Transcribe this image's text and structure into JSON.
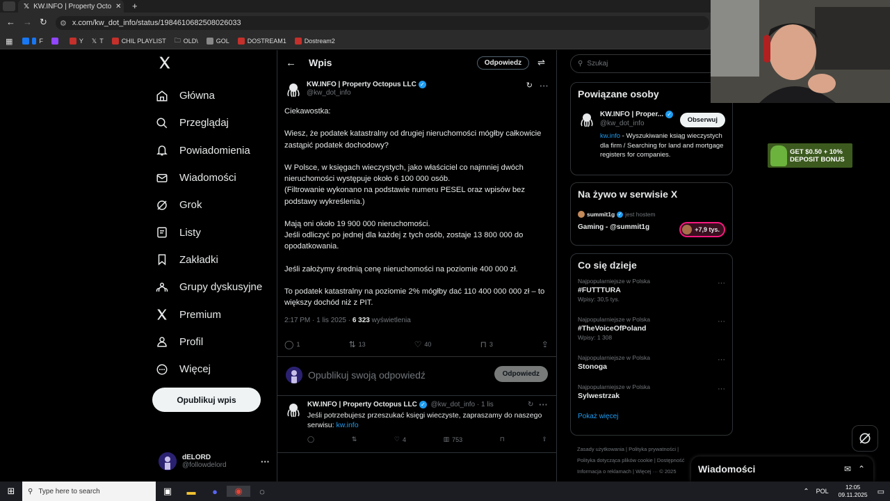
{
  "browser": {
    "tab_title": "KW.INFO | Property Octopus LL",
    "url": "x.com/kw_dot_info/status/1984610682508026033",
    "bookmarks": [
      "F",
      "",
      "Y",
      "T",
      "CHIL PLAYLIST",
      "OLD\\",
      "GOL",
      "DOSTREAM1",
      "Dostream2"
    ]
  },
  "nav": {
    "items": [
      "Główna",
      "Przeglądaj",
      "Powiadomienia",
      "Wiadomości",
      "Grok",
      "Listy",
      "Zakładki",
      "Grupy dyskusyjne",
      "Premium",
      "Profil",
      "Więcej"
    ],
    "post_button": "Opublikuj wpis"
  },
  "account": {
    "name": "dELORD",
    "handle": "@followdelord"
  },
  "main": {
    "title": "Wpis",
    "reply_button": "Odpowiedz",
    "tweet": {
      "author": "KW.INFO | Property Octopus LLC",
      "handle": "@kw_dot_info",
      "paragraphs": [
        "Ciekawostka:",
        "Wiesz, że podatek katastralny od drugiej nieruchomości mógłby całkowicie zastąpić podatek dochodowy?",
        "W Polsce, w księgach wieczystych, jako właściciel co najmniej dwóch nieruchomości występuje około 6 100 000 osób.\n(Filtrowanie wykonano na podstawie numeru PESEL oraz wpisów bez podstawy wykreślenia.)",
        "Mają oni około 19 900 000 nieruchomości.\nJeśli odliczyć po jednej dla każdej z tych osób, zostaje 13 800 000 do opodatkowania.",
        "Jeśli założymy średnią cenę nieruchomości na poziomie 400 000 zł.",
        "To podatek katastralny na poziomie 2% mógłby dać 110 400 000 000 zł – to większy dochód niż z PIT."
      ],
      "time": "2:17 PM · 1 lis 2025 ·",
      "views": "6 323",
      "views_label": "wyświetlenia",
      "replies": "1",
      "reposts": "13",
      "likes": "40",
      "bookmarks": "3"
    },
    "compose": {
      "placeholder": "Opublikuj swoją odpowiedź",
      "button": "Odpowiedz"
    },
    "reply": {
      "author": "KW.INFO | Property Octopus LLC",
      "handle": "@kw_dot_info · 1 lis",
      "text": "Jeśli potrzebujesz przeszukać księgi wieczyste, zapraszamy do naszego serwisu: ",
      "link": "kw.info",
      "likes": "4",
      "views": "753"
    }
  },
  "right": {
    "search_placeholder": "Szukaj",
    "related": {
      "title": "Powiązane osoby",
      "name": "KW.INFO | Proper...",
      "handle": "@kw_dot_info",
      "follow": "Obserwuj",
      "bio_link": "kw.info",
      "bio": " - Wyszukiwanie ksiąg wieczystych dla firm / Searching for land and mortgage registers for companies."
    },
    "live": {
      "title": "Na żywo w serwisie X",
      "host": "summit1g",
      "host_label": "jest hostem",
      "stream": "Gaming - @summit1g",
      "count": "+7,9 tys."
    },
    "trends": {
      "title": "Co się dzieje",
      "items": [
        {
          "category": "Najpopularniejsze w Polska",
          "title": "#FUTTTURA",
          "count": "Wpisy: 30,5 tys."
        },
        {
          "category": "Najpopularniejsze w Polska",
          "title": "#TheVoiceOfPoland",
          "count": "Wpisy: 1 308"
        },
        {
          "category": "Najpopularniejsze w Polska",
          "title": "Stonoga",
          "count": ""
        },
        {
          "category": "Najpopularniejsze w Polska",
          "title": "Sylwestrzak",
          "count": ""
        }
      ],
      "show_more": "Pokaż więcej"
    },
    "footer": {
      "line1": "Zasady użytkowania   |   Polityka prywatności   |",
      "line2": "Polityka dotycząca plików cookie   |   Dostępność",
      "line3": "Informacja o reklamach   |   Więcej ···   © 2025"
    },
    "messages": "Wiadomości"
  },
  "ad": {
    "line1": "GET $0.50 + 10%",
    "line2": "DEPOSIT BONUS"
  },
  "taskbar": {
    "search": "Type here to search",
    "lang": "POL",
    "time": "12:05",
    "date": "09.11.2025"
  },
  "colors": {
    "accent": "#1d9bf0",
    "background": "#000000",
    "border": "#2f3336",
    "muted": "#71767b",
    "live": "#f91880"
  }
}
